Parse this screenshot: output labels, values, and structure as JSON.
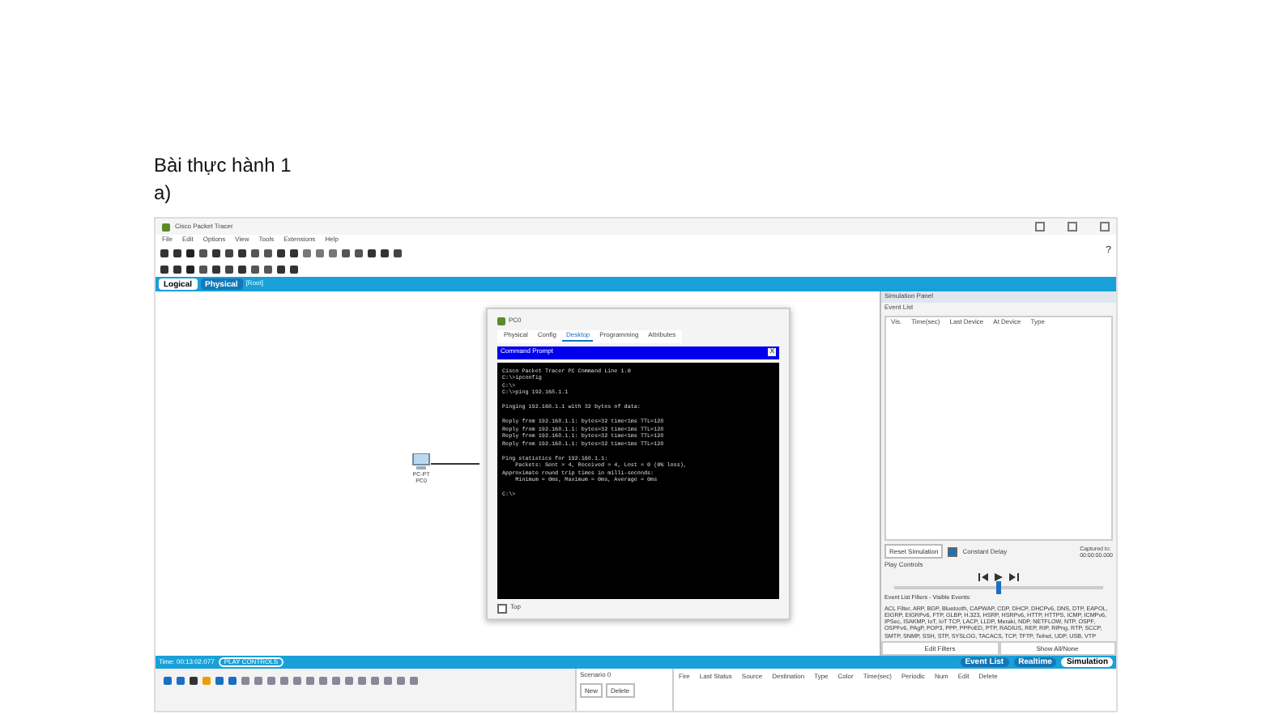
{
  "document": {
    "heading": "Bài thực hành 1",
    "subheading": "a)"
  },
  "app": {
    "title": "Cisco Packet Tracer",
    "menu": [
      "File",
      "Edit",
      "Options",
      "View",
      "Tools",
      "Extensions",
      "Help"
    ],
    "help_mark": "?",
    "workspace_tabs": [
      {
        "label": "Logical",
        "selected": true
      },
      {
        "label": "Physical",
        "selected": false
      }
    ],
    "workspace_path": "[Root]",
    "device": {
      "model": "PC-PT",
      "name": "PC0"
    },
    "pc_window": {
      "title": "PC0",
      "tabs": [
        {
          "label": "Physical",
          "selected": false
        },
        {
          "label": "Config",
          "selected": false
        },
        {
          "label": "Desktop",
          "selected": true
        },
        {
          "label": "Programming",
          "selected": false
        },
        {
          "label": "Attributes",
          "selected": false
        }
      ],
      "panel_title": "Command Prompt",
      "panel_close": "X",
      "console_blocks": [
        [
          "Cisco Packet Tracer PC Command Line 1.0",
          "C:\\>ipconfig",
          "C:\\>",
          "C:\\>ping 192.168.1.1"
        ],
        [
          "Pinging 192.168.1.1 with 32 bytes of data:"
        ],
        [
          "Reply from 192.168.1.1: bytes=32 time<1ms TTL=128",
          "Reply from 192.168.1.1: bytes=32 time<1ms TTL=128",
          "Reply from 192.168.1.1: bytes=32 time<1ms TTL=128",
          "Reply from 192.168.1.1: bytes=32 time<1ms TTL=128"
        ],
        [
          "Ping statistics for 192.168.1.1:",
          "    Packets: Sent = 4, Received = 4, Lost = 0 (0% loss),",
          "Approximate round trip times in milli-seconds:",
          "    Minimum = 0ms, Maximum = 0ms, Average = 0ms"
        ],
        [
          "C:\\>"
        ]
      ],
      "top_label": "Top",
      "top_checked": false
    },
    "simulation_panel": {
      "title": "Simulation Panel",
      "event_list_label": "Event List",
      "columns": [
        "Vis.",
        "Time(sec)",
        "Last Device",
        "At Device",
        "Type"
      ],
      "reset_button": "Reset Simulation",
      "constant_delay": {
        "label": "Constant Delay",
        "checked": true
      },
      "captured_label": "Captured to:",
      "captured_value": "00:00:00.000",
      "play_controls_label": "Play Controls",
      "slider": {
        "level": 0.5
      },
      "filters_title": "Event List Filters - Visible Events:",
      "filters_text": "ACL Filter, ARP, BGP, Bluetooth, CAPWAP, CDP, DHCP, DHCPv6, DNS, DTP, EAPOL, EIGRP, EIGRPv6, FTP, GLBP, H.323, HSRP, HSRPv6, HTTP, HTTPS, ICMP, ICMPv6, IPSec, ISAKMP, IoT, IoT TCP, LACP, LLDP, Meraki, NDP, NETFLOW, NTP, OSPF, OSPFv6, PAgP, POP3, PPP, PPPoED, PTP, RADIUS, REP, RIP, RIPng, RTP, SCCP, SMTP, SNMP, SSH, STP, SYSLOG, TACACS, TCP, TFTP, Telnet, UDP, USB, VTP",
      "buttons": [
        "Edit Filters",
        "Show All/None"
      ]
    },
    "status_bar": {
      "time": "Time: 00:13:02.077",
      "play_controls": "PLAY CONTROLS",
      "modes": [
        {
          "label": "Event List",
          "selected": false
        },
        {
          "label": "Realtime",
          "selected": false
        },
        {
          "label": "Simulation",
          "selected": true
        }
      ]
    },
    "scenario": {
      "value": "Scenario 0",
      "buttons": [
        "New",
        "Delete"
      ]
    },
    "pdu_columns": [
      "Fire",
      "Last Status",
      "Source",
      "Destination",
      "Type",
      "Color",
      "Time(sec)",
      "Periodic",
      "Num",
      "Edit",
      "Delete"
    ]
  }
}
